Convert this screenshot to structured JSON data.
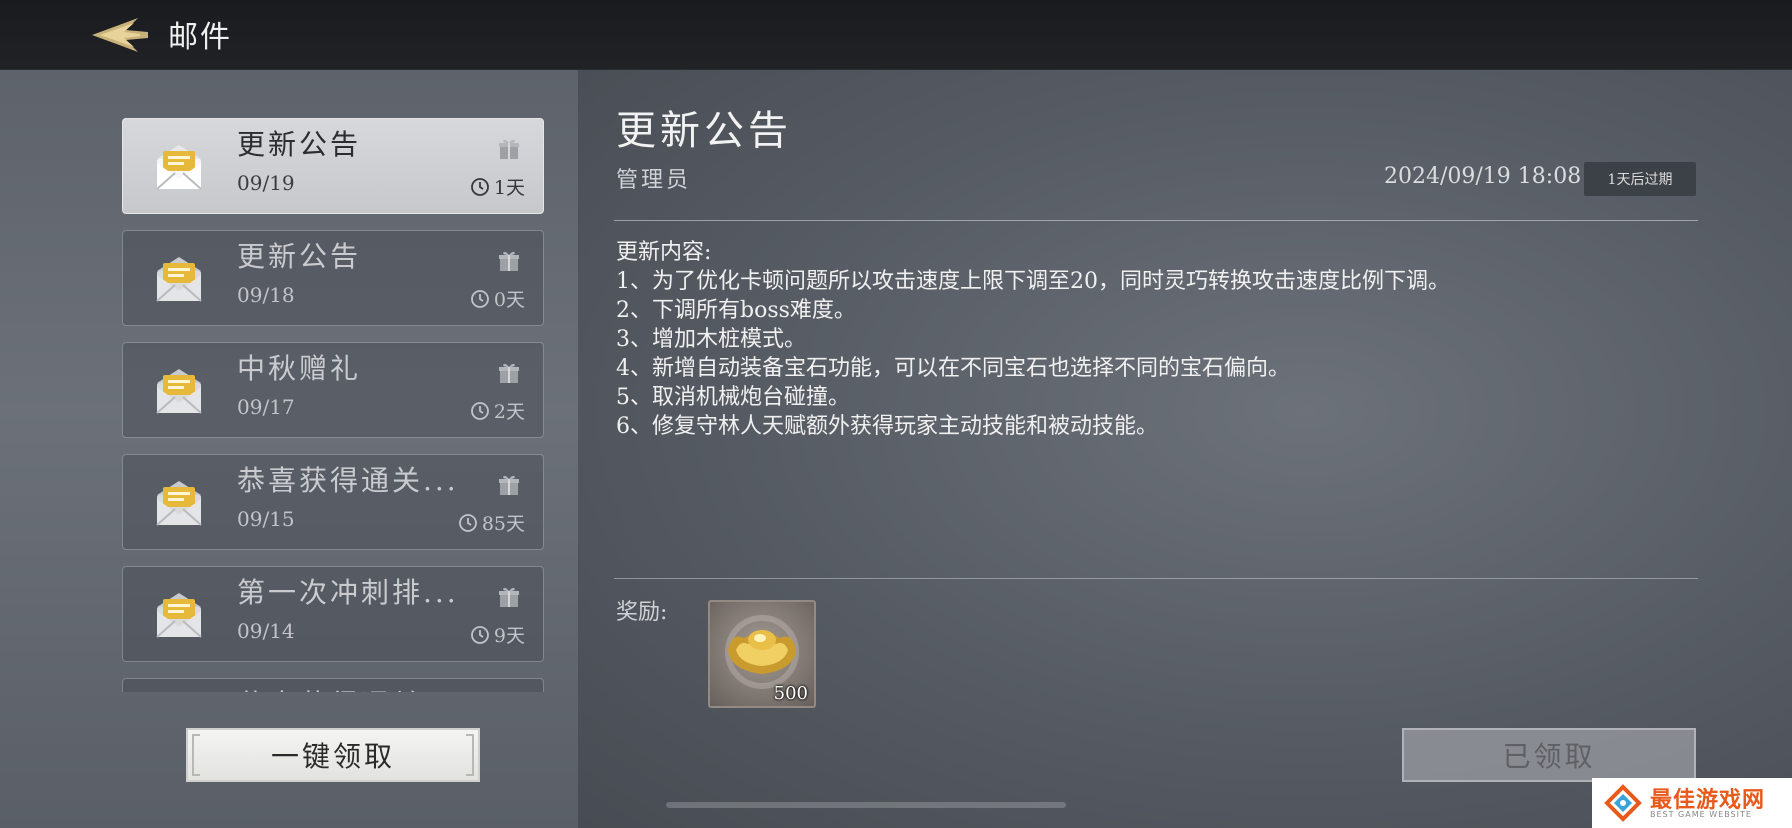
{
  "header": {
    "title": "邮件"
  },
  "mail_list": [
    {
      "title": "更新公告",
      "date": "09/19",
      "expire": "1天",
      "selected": true
    },
    {
      "title": "更新公告",
      "date": "09/18",
      "expire": "0天",
      "selected": false
    },
    {
      "title": "中秋赠礼",
      "date": "09/17",
      "expire": "2天",
      "selected": false
    },
    {
      "title": "恭喜获得通关...",
      "date": "09/15",
      "expire": "85天",
      "selected": false
    },
    {
      "title": "第一次冲刺排...",
      "date": "09/14",
      "expire": "9天",
      "selected": false
    },
    {
      "title": "恭喜获得通关",
      "date": "",
      "expire": "",
      "selected": false
    }
  ],
  "claim_all_label": "一键领取",
  "detail": {
    "title": "更新公告",
    "sender": "管理员",
    "datetime": "2024/09/19 18:08",
    "expire_badge": "1天后过期",
    "content_heading": "更新内容:",
    "content_lines": [
      "1、为了优化卡顿问题所以攻击速度上限下调至20，同时灵巧转换攻击速度比例下调。",
      "2、下调所有boss难度。",
      "3、增加木桩模式。",
      "4、新增自动装备宝石功能，可以在不同宝石也选择不同的宝石偏向。",
      "5、取消机械炮台碰撞。",
      "6、修复守林人天赋额外获得玩家主动技能和被动技能。"
    ],
    "reward_label": "奖励:",
    "reward_item": {
      "icon": "gold-ingot-icon",
      "quantity": "500"
    },
    "claimed_label": "已领取"
  },
  "watermark": {
    "text": "最佳游戏网",
    "sub": "BEST GAME WEBSITE"
  },
  "colors": {
    "selected_bg": "#cfd1d4",
    "envelope_gold": "#e6b93a",
    "watermark_orange": "#e85a1b"
  }
}
